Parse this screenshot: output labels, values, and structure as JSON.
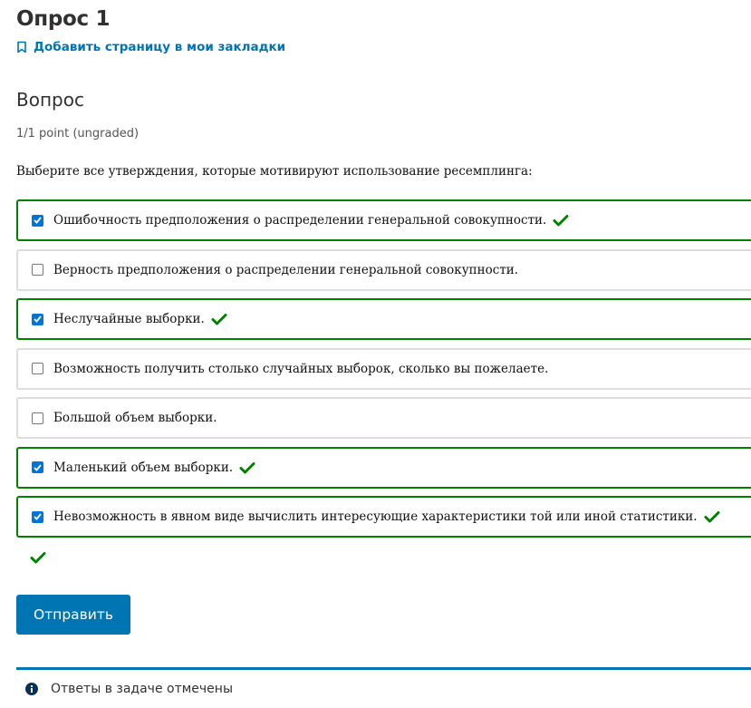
{
  "page": {
    "title": "Опрос 1",
    "bookmark_label": "Добавить страницу в мои закладки"
  },
  "question": {
    "heading": "Вопрос",
    "points": "1/1 point (ungraded)",
    "prompt": "Выберите все утверждения, которые мотивируют использование ресемплинга:",
    "options": [
      {
        "label": "Ошибочность предположения о распределении генеральной совокупности.",
        "checked": true,
        "correct": true
      },
      {
        "label": "Верность предположения о распределении генеральной совокупности.",
        "checked": false,
        "correct": false
      },
      {
        "label": "Неслучайные выборки.",
        "checked": true,
        "correct": true
      },
      {
        "label": "Возможность получить столько случайных выборок, сколько вы пожелаете.",
        "checked": false,
        "correct": false
      },
      {
        "label": "Большой объем выборки.",
        "checked": false,
        "correct": false
      },
      {
        "label": "Маленький объем выборки.",
        "checked": true,
        "correct": true
      },
      {
        "label": "Невозможность в явном виде вычислить интересующие характеристики той или иной статистики.",
        "checked": true,
        "correct": true
      }
    ],
    "result": "correct"
  },
  "actions": {
    "submit_label": "Отправить"
  },
  "notice": {
    "icon": "info-icon",
    "text": "Ответы в задаче отмечены"
  },
  "colors": {
    "accent": "#0075b4",
    "correct": "#008100",
    "checkbox": "#0075d8"
  }
}
